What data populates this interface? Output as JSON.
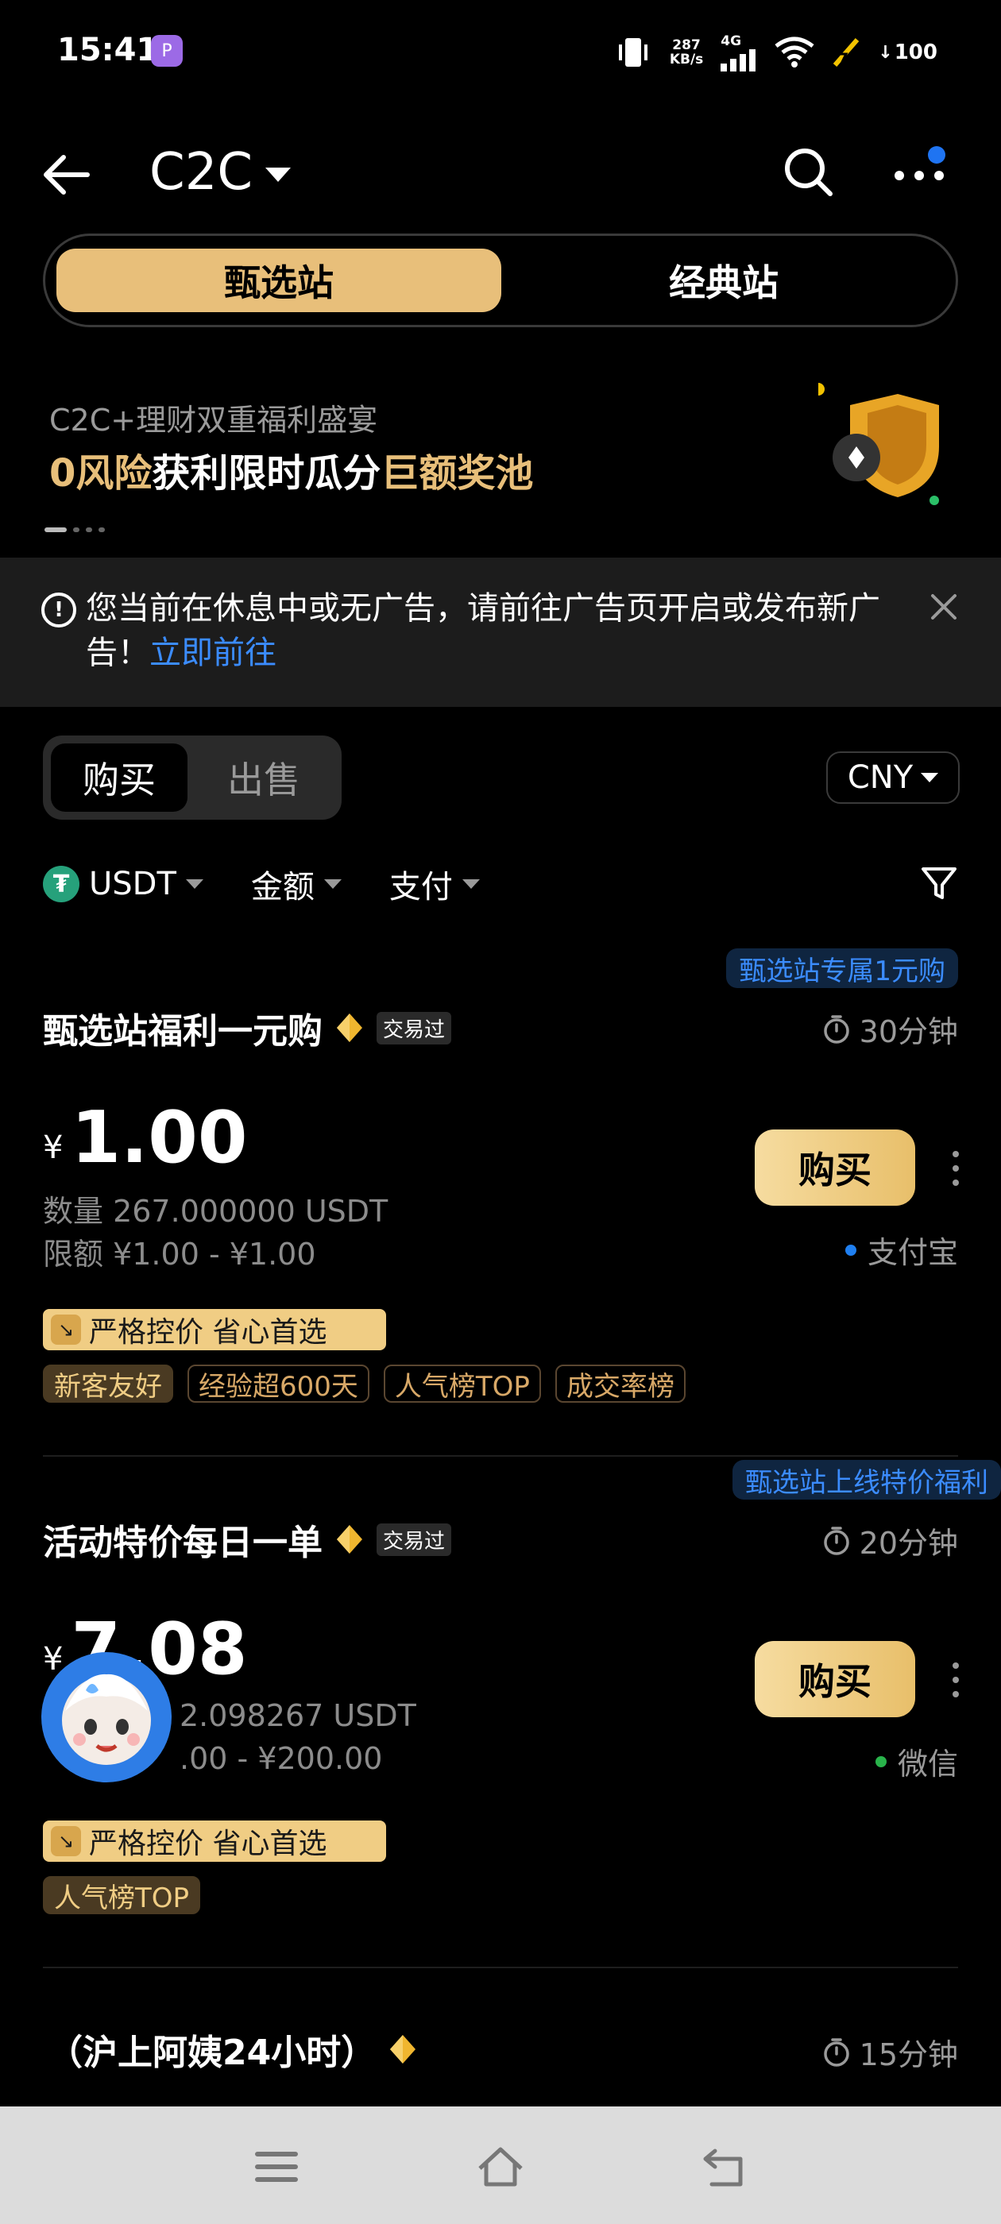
{
  "status_bar": {
    "time": "15:41",
    "app_icon": "P",
    "net_speed_value": "287",
    "net_speed_unit": "KB/s",
    "signal": "4G",
    "battery": "100"
  },
  "header": {
    "title": "C2C"
  },
  "station_tabs": {
    "active": "甄选站",
    "inactive": "经典站"
  },
  "banner": {
    "subtitle": "C2C+理财双重福利盛宴",
    "title_hl1": "0风险",
    "title_mid": "获利限时瓜分",
    "title_hl2": "巨额奖池"
  },
  "notice": {
    "text": "您当前在休息中或无广告，请前往广告页开启或发布新广告！",
    "link": "立即前往"
  },
  "trade_tabs": {
    "buy": "购买",
    "sell": "出售"
  },
  "currency": "CNY",
  "filters": {
    "coin": "USDT",
    "amount": "金额",
    "payment": "支付"
  },
  "ads": [
    {
      "promo": "甄选站专属1元购",
      "name": "甄选站福利一元购",
      "traded_badge": "交易过",
      "time": "30分钟",
      "currency_symbol": "¥",
      "price": "1.00",
      "quantity": "数量 267.000000 USDT",
      "limit": "限额 ¥1.00 - ¥1.00",
      "buy_label": "购买",
      "payment": "支付宝",
      "payment_color": "#1f7ff0",
      "strict_label": "严格控价 省心首选",
      "tags": [
        "新客友好",
        "经验超600天",
        "人气榜TOP",
        "成交率榜"
      ]
    },
    {
      "promo": "甄选站上线特价福利",
      "name": "活动特价每日一单",
      "traded_badge": "交易过",
      "time": "20分钟",
      "currency_symbol": "¥",
      "price": "7.08",
      "quantity": "2.098267 USDT",
      "limit": ".00 - ¥200.00",
      "buy_label": "购买",
      "payment": "微信",
      "payment_color": "#29b34b",
      "strict_label": "严格控价 省心首选",
      "tags": [
        "人气榜TOP"
      ]
    },
    {
      "name": "（沪上阿姨24小时）",
      "time": "15分钟"
    }
  ]
}
